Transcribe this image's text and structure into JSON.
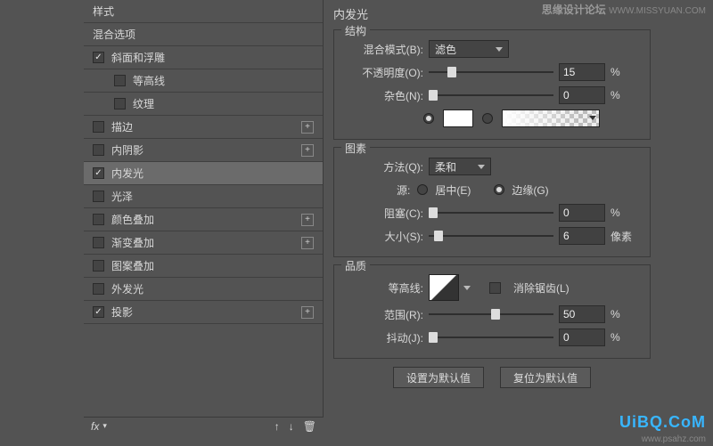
{
  "left": {
    "header1": "样式",
    "header2": "混合选项",
    "items": [
      {
        "label": "斜面和浮雕",
        "checked": true,
        "add": false,
        "indent": false
      },
      {
        "label": "等高线",
        "checked": false,
        "add": false,
        "indent": true
      },
      {
        "label": "纹理",
        "checked": false,
        "add": false,
        "indent": true
      },
      {
        "label": "描边",
        "checked": false,
        "add": true,
        "indent": false
      },
      {
        "label": "内阴影",
        "checked": false,
        "add": true,
        "indent": false
      },
      {
        "label": "内发光",
        "checked": true,
        "add": false,
        "indent": false,
        "selected": true
      },
      {
        "label": "光泽",
        "checked": false,
        "add": false,
        "indent": false
      },
      {
        "label": "颜色叠加",
        "checked": false,
        "add": true,
        "indent": false
      },
      {
        "label": "渐变叠加",
        "checked": false,
        "add": true,
        "indent": false
      },
      {
        "label": "图案叠加",
        "checked": false,
        "add": false,
        "indent": false
      },
      {
        "label": "外发光",
        "checked": false,
        "add": false,
        "indent": false
      },
      {
        "label": "投影",
        "checked": true,
        "add": true,
        "indent": false
      }
    ],
    "fx": "fx"
  },
  "right": {
    "title": "内发光",
    "struct": {
      "legend": "结构",
      "blend_label": "混合模式(B):",
      "blend_value": "滤色",
      "opacity_label": "不透明度(O):",
      "opacity_value": "15",
      "opacity_unit": "%",
      "noise_label": "杂色(N):",
      "noise_value": "0",
      "noise_unit": "%"
    },
    "elem": {
      "legend": "图素",
      "method_label": "方法(Q):",
      "method_value": "柔和",
      "source_label": "源:",
      "source_center": "居中(E)",
      "source_edge": "边缘(G)",
      "choke_label": "阻塞(C):",
      "choke_value": "0",
      "choke_unit": "%",
      "size_label": "大小(S):",
      "size_value": "6",
      "size_unit": "像素"
    },
    "qual": {
      "legend": "品质",
      "contour_label": "等高线:",
      "aa_label": "消除锯齿(L)",
      "range_label": "范围(R):",
      "range_value": "50",
      "range_unit": "%",
      "jitter_label": "抖动(J):",
      "jitter_value": "0",
      "jitter_unit": "%"
    },
    "btn_default": "设置为默认值",
    "btn_reset": "复位为默认值"
  },
  "watermark": {
    "top1": "思缘设计论坛",
    "top2": "WWW.MISSYUAN.COM",
    "logo": "UiBQ.CoM",
    "url": "www.psahz.com"
  }
}
